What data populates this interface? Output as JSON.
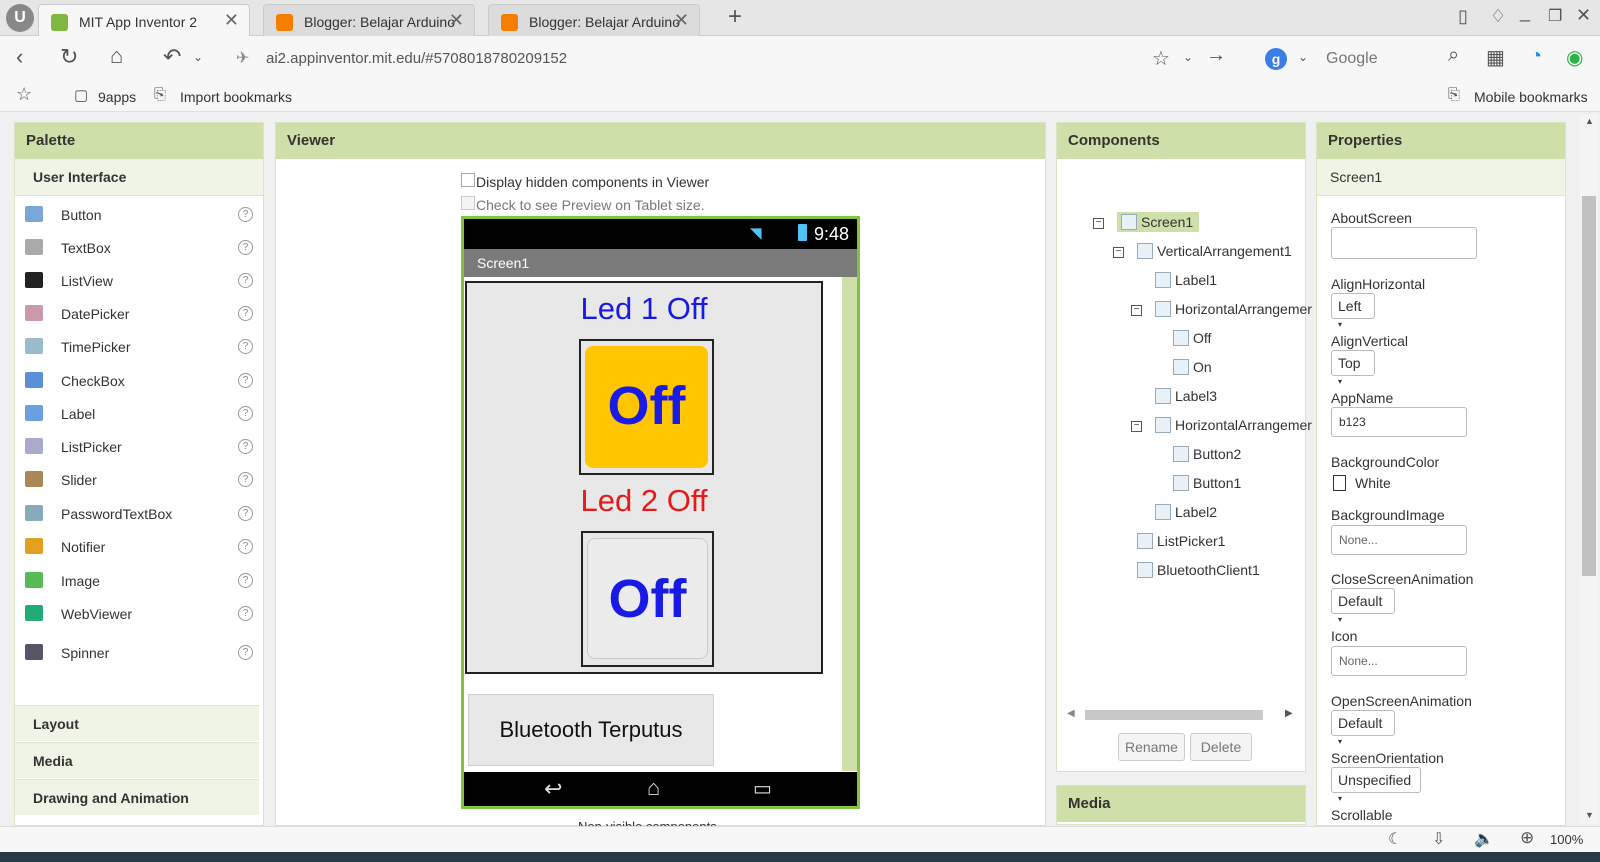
{
  "browser": {
    "tabs": [
      {
        "title": "MIT App Inventor 2",
        "active": true
      },
      {
        "title": "Blogger: Belajar Arduino",
        "active": false
      },
      {
        "title": "Blogger: Belajar Arduino",
        "active": false
      }
    ],
    "url": "ai2.appinventor.mit.edu/#5708018780209152",
    "search_engine": "Google",
    "bookmarks": [
      "9apps",
      "Import bookmarks"
    ],
    "mobile_bookmarks": "Mobile bookmarks",
    "zoom": "100%"
  },
  "palette": {
    "title": "Palette",
    "category": "User Interface",
    "items": [
      "Button",
      "TextBox",
      "ListView",
      "DatePicker",
      "TimePicker",
      "CheckBox",
      "Label",
      "ListPicker",
      "Slider",
      "PasswordTextBox",
      "Notifier",
      "Image",
      "WebViewer",
      "Spinner"
    ],
    "help_glyph": "?",
    "other_categories": [
      "Layout",
      "Media",
      "Drawing and Animation"
    ]
  },
  "viewer": {
    "title": "Viewer",
    "checkbox_hidden": "Display hidden components in Viewer",
    "checkbox_tablet": "Check to see Preview on Tablet size.",
    "phone": {
      "time": "9:48",
      "screen_title": "Screen1",
      "label1": "Led 1 Off",
      "button1": "Off",
      "label2": "Led 2 Off",
      "button2": "Off",
      "bt_status": "Bluetooth Terputus"
    },
    "nonvisible_label": "Non-visible components"
  },
  "components": {
    "title": "Components",
    "tree": [
      {
        "name": "Screen1",
        "icon": "screen-icon",
        "toggle": "⊟",
        "selected": true
      },
      {
        "name": "VerticalArrangement1",
        "icon": "vertical-arrangement-icon",
        "toggle": "⊟"
      },
      {
        "name": "Label1",
        "icon": "label-icon"
      },
      {
        "name": "HorizontalArrangemer",
        "icon": "horizontal-arrangement-icon",
        "toggle": "⊟"
      },
      {
        "name": "Off",
        "icon": "button-icon"
      },
      {
        "name": "On",
        "icon": "button-icon"
      },
      {
        "name": "Label3",
        "icon": "label-icon"
      },
      {
        "name": "HorizontalArrangemer",
        "icon": "horizontal-arrangement-icon",
        "toggle": "⊟"
      },
      {
        "name": "Button2",
        "icon": "button-icon"
      },
      {
        "name": "Button1",
        "icon": "button-icon"
      },
      {
        "name": "Label2",
        "icon": "label-icon"
      },
      {
        "name": "ListPicker1",
        "icon": "listpicker-icon"
      },
      {
        "name": "BluetoothClient1",
        "icon": "bluetooth-icon"
      }
    ],
    "rename": "Rename",
    "delete": "Delete",
    "media_title": "Media"
  },
  "properties": {
    "title": "Properties",
    "component": "Screen1",
    "about_label": "AboutScreen",
    "about_value": "",
    "align_h_label": "AlignHorizontal",
    "align_h_value": "Left",
    "align_v_label": "AlignVertical",
    "align_v_value": "Top",
    "appname_label": "AppName",
    "appname_value": "b123",
    "bgcolor_label": "BackgroundColor",
    "bgcolor_value": "White",
    "bgimage_label": "BackgroundImage",
    "bgimage_value": "None...",
    "close_anim_label": "CloseScreenAnimation",
    "close_anim_value": "Default",
    "icon_label": "Icon",
    "icon_value": "None...",
    "open_anim_label": "OpenScreenAnimation",
    "open_anim_value": "Default",
    "orientation_label": "ScreenOrientation",
    "orientation_value": "Unspecified",
    "scrollable_label": "Scrollable"
  },
  "colors": {
    "header_green": "#cfdfa9",
    "button_yellow": "#ffc600",
    "blue_text": "#1a1ae6",
    "red_text": "#e61a1a",
    "phone_border": "#7fc341"
  }
}
